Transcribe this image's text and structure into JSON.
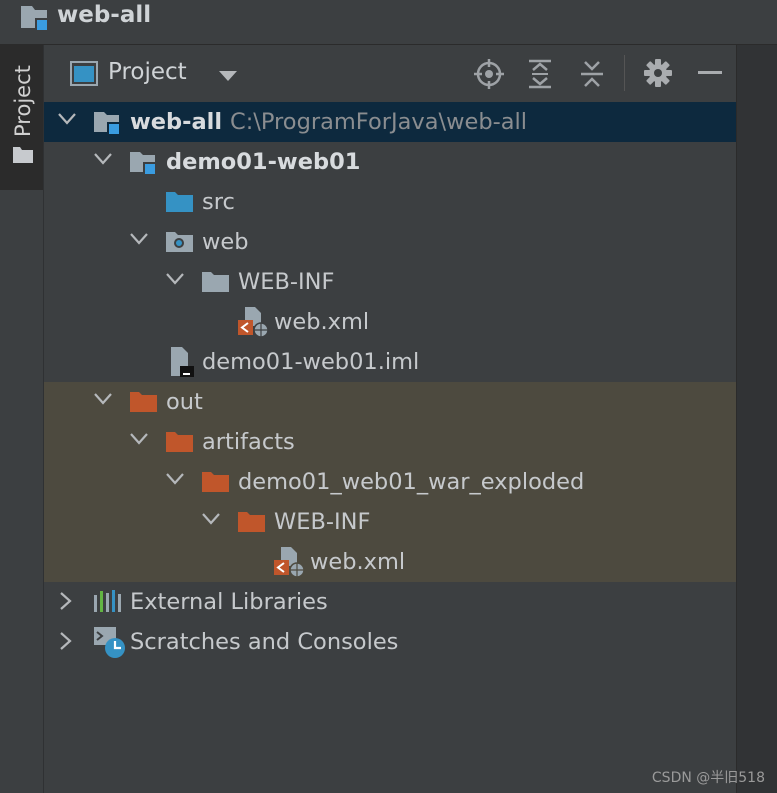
{
  "window": {
    "title": "web-all"
  },
  "tool_strip": {
    "project_label": "Project"
  },
  "panel": {
    "title": "Project",
    "icons": [
      "locate-icon",
      "expand-all-icon",
      "collapse-all-icon",
      "gear-icon",
      "hide-icon"
    ]
  },
  "tree": {
    "root": {
      "name": "web-all",
      "path": "C:\\ProgramForJava\\web-all"
    },
    "module": {
      "name": "demo01-web01"
    },
    "src": {
      "name": "src"
    },
    "web": {
      "name": "web"
    },
    "web_inf": {
      "name": "WEB-INF"
    },
    "web_xml": {
      "name": "web.xml"
    },
    "iml": {
      "name": "demo01-web01.iml"
    },
    "out": {
      "name": "out"
    },
    "artifacts": {
      "name": "artifacts"
    },
    "exploded": {
      "name": "demo01_web01_war_exploded"
    },
    "out_web_inf": {
      "name": "WEB-INF"
    },
    "out_web_xml": {
      "name": "web.xml"
    },
    "ext_libs": {
      "name": "External Libraries"
    },
    "scratches": {
      "name": "Scratches and Consoles"
    }
  },
  "colors": {
    "selection": "#0d293e",
    "excluded": "#4d4a3f",
    "folder_excluded": "#c0562b",
    "folder_source": "#3592c4",
    "folder_plain": "#9aa7b0"
  },
  "watermark": "CSDN @半旧518"
}
